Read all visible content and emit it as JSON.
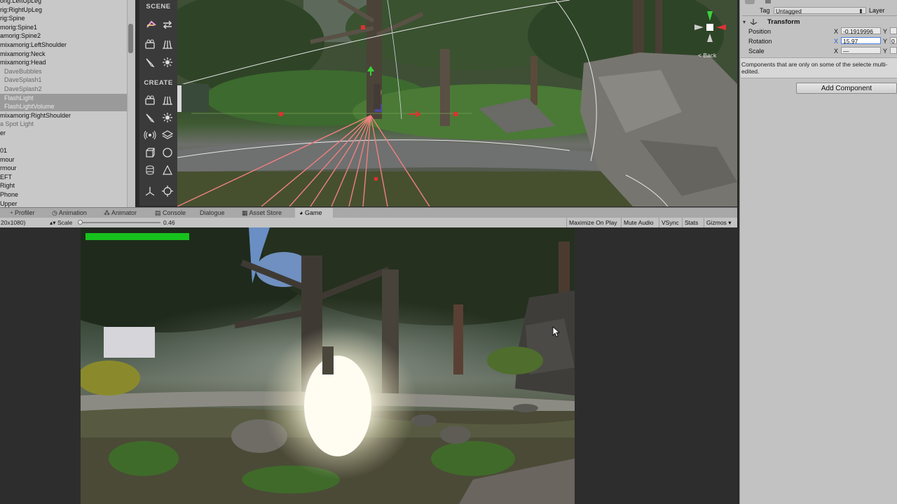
{
  "hierarchy": {
    "items": [
      {
        "label": "orig:LeftUpLeg",
        "style": "normal"
      },
      {
        "label": "rig:RightUpLeg",
        "style": "normal"
      },
      {
        "label": "rig:Spine",
        "style": "normal"
      },
      {
        "label": "morig:Spine1",
        "style": "normal"
      },
      {
        "label": "amorig:Spine2",
        "style": "normal"
      },
      {
        "label": "mixamorig:LeftShoulder",
        "style": "normal"
      },
      {
        "label": "mixamorig:Neck",
        "style": "normal"
      },
      {
        "label": "mixamorig:Head",
        "style": "normal"
      },
      {
        "label": "DaveBubbles",
        "style": "dim"
      },
      {
        "label": "DaveSplash1",
        "style": "dim"
      },
      {
        "label": "DaveSplash2",
        "style": "dim"
      },
      {
        "label": "FlashLight",
        "style": "sel"
      },
      {
        "label": "FlashLightVolume",
        "style": "sel"
      },
      {
        "label": "mixamorig:RightShoulder",
        "style": "normal"
      },
      {
        "label": "a Spot Light",
        "style": "dim"
      },
      {
        "label": "er",
        "style": "normal"
      },
      {
        "label": "",
        "style": "normal"
      },
      {
        "label": "01",
        "style": "normal"
      },
      {
        "label": "mour",
        "style": "normal"
      },
      {
        "label": "rmour",
        "style": "normal"
      },
      {
        "label": "EFT",
        "style": "normal"
      },
      {
        "label": "Right",
        "style": "normal"
      },
      {
        "label": "Phone",
        "style": "normal"
      },
      {
        "label": "Upper",
        "style": "normal"
      }
    ]
  },
  "palette": {
    "scene_title": "SCENE",
    "create_title": "CREATE"
  },
  "scene": {
    "back_label": "< Back"
  },
  "tabs": [
    {
      "label": "Profiler",
      "icon": "profiler-icon"
    },
    {
      "label": "Animation",
      "icon": "animation-icon"
    },
    {
      "label": "Animator",
      "icon": "animator-icon"
    },
    {
      "label": "Console",
      "icon": "console-icon"
    },
    {
      "label": "Dialogue",
      "icon": ""
    },
    {
      "label": "Asset Store",
      "icon": "asset-store-icon"
    },
    {
      "label": "Game",
      "icon": "game-icon"
    }
  ],
  "gamebar": {
    "resolution": "20x1080)",
    "scale_label": "Scale",
    "scale_value": "0.46",
    "scale_fraction": 0.0,
    "maximize": "Maximize On Play",
    "mute": "Mute Audio",
    "vsync": "VSync",
    "stats": "Stats",
    "gizmos": "Gizmos"
  },
  "game": {
    "health_fraction": 1.0,
    "health_color": "#16c21c"
  },
  "inspector": {
    "tag_label": "Tag",
    "tag_value": "Untagged",
    "layer_label": "Layer",
    "transform_title": "Transform",
    "position_label": "Position",
    "rotation_label": "Rotation",
    "scale_label": "Scale",
    "x_label": "X",
    "y_label": "Y",
    "position_x": "-0.1919996",
    "rotation_x": "15.97",
    "scale_x": "—",
    "rotation_y": "0",
    "note": "Components that are only on some of the selecte multi-edited.",
    "add_component": "Add Component"
  }
}
